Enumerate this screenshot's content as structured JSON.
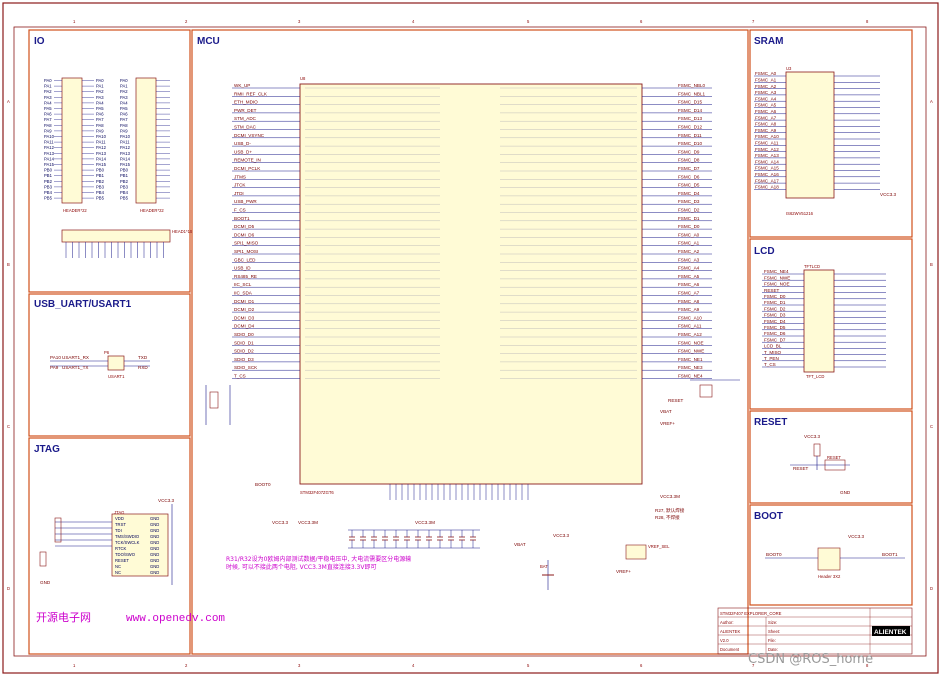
{
  "border": {
    "columns": [
      "1",
      "2",
      "3",
      "4",
      "5",
      "6",
      "7",
      "8"
    ],
    "rows": [
      "A",
      "B",
      "C",
      "D"
    ]
  },
  "sections": {
    "io": "IO",
    "mcu": "MCU",
    "sram": "SRAM",
    "lcd": "LCD",
    "usb_uart": "USB_UART/USART1",
    "jtag": "JTAG",
    "reset": "RESET",
    "boot": "BOOT"
  },
  "parts": {
    "mcu_ref": "U8",
    "mcu_part": "STM32F407ZGT6",
    "sram_ref": "U3",
    "sram_part": "IS62WV51216",
    "lcd_ref": "TFTLCD",
    "lcd_label": "TFT_LCD",
    "jtag_label": "JTAG",
    "usart_label": "USART1",
    "io_header_a": "HEADER*22",
    "io_header_b": "HEADER*22",
    "io_header_c": "HEAD1*16",
    "boot_header": "Header 3X2",
    "reset_label": "RESET",
    "uart_p6": "P6",
    "bkp_ref": "BAT",
    "vref_ref": "VREF_SEL"
  },
  "nets": {
    "vcc33": "VCC3.3",
    "vcc33m": "VCC3.3M",
    "gnd": "GND",
    "vbat": "VBAT",
    "vref": "VREF+",
    "boot0": "BOOT0",
    "boot1": "BOOT1",
    "reset": "RESET",
    "pa10": "PA10",
    "pa9": "PA9",
    "usart_rx": "USART1_RX",
    "usart_tx": "USART1_TX",
    "txd": "TXD",
    "rxd": "RXD"
  },
  "notes": {
    "caps_note_l1": "R31/R32设为0欧姆内部测试数据/平稳电压中, 大电流需要区分电源输",
    "caps_note_l2": "时候, 可以不接此两个电阻, VCC3.3M直接连接3.3V即可",
    "boot_note_l1": "R27, 默认焊接",
    "boot_note_l2": "R28, 不焊接"
  },
  "watermark": {
    "brand": "开源电子网",
    "url": "www.openedv.com",
    "csdn": "CSDN @ROS_home"
  },
  "titleblock": {
    "title": "STM32F407 EXPLORER_CORE",
    "author": "Author:",
    "company": "ALIENTEK",
    "rev": "V2.0",
    "logo": "ALIENTEK",
    "size": "Size:",
    "sheet": "Sheet:",
    "file": "File:",
    "date": "Date:",
    "rev_label": "Revision:",
    "doc_label": "Document"
  },
  "mcu_pins_left": [
    "WK_UP",
    "RMII_REF_CLK",
    "ETH_MDIO",
    "PWR_DET",
    "STM_ADC",
    "STM_DAC",
    "DCMI_VSYNC",
    "USB_D-",
    "USB_D+",
    "REMOTE_IN",
    "DCMI_PCLK",
    "JTMS",
    "JTCK",
    "JTDI",
    "USB_PWR",
    "F_CS",
    "BOOT1",
    "DCMI_D5",
    "DCMI_D6",
    "SPI1_MISO",
    "SPI1_MOSI",
    "GBC_LED",
    "USB_ID",
    "RS485_RE",
    "IIC_SCL",
    "IIC_SDA",
    "DCMI_D1",
    "DCMI_D2",
    "DCMI_D3",
    "DCMI_D4",
    "SDIO_D0",
    "SDIO_D1",
    "SDIO_D2",
    "SDIO_D3",
    "SDIO_SCK",
    "T_CS"
  ],
  "mcu_pins_right": [
    "FSMC_NBL0",
    "FSMC_NBL1",
    "FSMC_D15",
    "FSMC_D14",
    "FSMC_D13",
    "FSMC_D12",
    "FSMC_D11",
    "FSMC_D10",
    "FSMC_D9",
    "FSMC_D8",
    "FSMC_D7",
    "FSMC_D6",
    "FSMC_D5",
    "FSMC_D4",
    "FSMC_D3",
    "FSMC_D2",
    "FSMC_D1",
    "FSMC_D0",
    "FSMC_A0",
    "FSMC_A1",
    "FSMC_A2",
    "FSMC_A3",
    "FSMC_A4",
    "FSMC_A5",
    "FSMC_A6",
    "FSMC_A7",
    "FSMC_A8",
    "FSMC_A9",
    "FSMC_A10",
    "FSMC_A11",
    "FSMC_A12",
    "FSMC_NOE",
    "FSMC_NWE",
    "FSMC_NE1",
    "FSMC_NE3",
    "FSMC_NE4"
  ],
  "sram_pins": [
    "FSMC_A0",
    "FSMC_A1",
    "FSMC_A2",
    "FSMC_A3",
    "FSMC_A4",
    "FSMC_A5",
    "FSMC_A6",
    "FSMC_A7",
    "FSMC_A8",
    "FSMC_A9",
    "FSMC_A10",
    "FSMC_A11",
    "FSMC_A12",
    "FSMC_A13",
    "FSMC_A14",
    "FSMC_A15",
    "FSMC_A16",
    "FSMC_A17",
    "FSMC_A18"
  ],
  "lcd_pins": [
    "FSMC_NE4",
    "FSMC_NWE",
    "FSMC_NOE",
    "RESET",
    "FSMC_D0",
    "FSMC_D1",
    "FSMC_D2",
    "FSMC_D3",
    "FSMC_D4",
    "FSMC_D5",
    "FSMC_D6",
    "FSMC_D7",
    "LCD_BL",
    "T_MISO",
    "T_PEN",
    "T_CS"
  ],
  "jtag_pins": [
    "VDD",
    "TRST",
    "TDI",
    "TMS/SWDIO",
    "TCK/SWCLK",
    "RTCK",
    "TDO/SWO",
    "RESET",
    "NC",
    "NC"
  ],
  "io_rows": [
    "PA0",
    "PA1",
    "PA2",
    "PA3",
    "PA4",
    "PA5",
    "PA6",
    "PA7",
    "PA8",
    "PA9",
    "PA10",
    "PA11",
    "PA12",
    "PA13",
    "PA14",
    "PA15",
    "PB0",
    "PB1",
    "PB2",
    "PB3",
    "PB4",
    "PB5"
  ]
}
